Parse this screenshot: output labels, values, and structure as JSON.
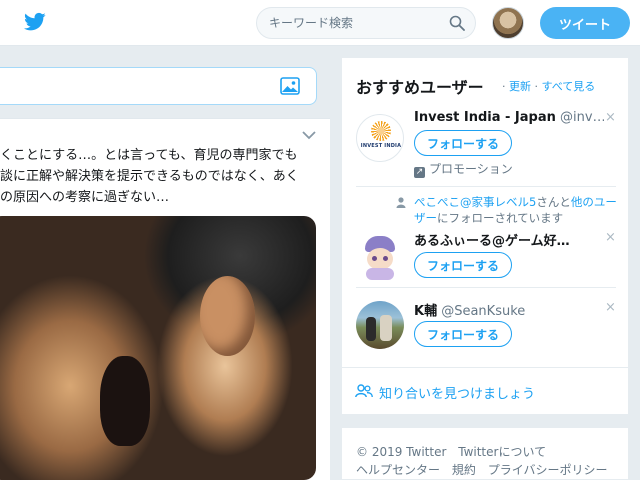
{
  "header": {
    "search_placeholder": "キーワード検索",
    "tweet_button": "ツイート"
  },
  "tweet": {
    "lines": [
      "くことにする…。とは言っても、育児の専門家でも",
      "談に正解や解決策を提示できるものではなく、あく",
      "の原因への考察に過ぎない…"
    ]
  },
  "who_to_follow": {
    "title": "おすすめユーザー",
    "separator": "·",
    "refresh": "更新",
    "view_all": "すべて見る",
    "follow_label": "フォローする",
    "dismiss": "×",
    "users": [
      {
        "name": "Invest India - Japan",
        "handle": "@inv…",
        "promoted": "プロモーション",
        "avatar_text": "INVEST INDIA"
      },
      {
        "context_link": "ぺこぺこ@家事レベル5",
        "context_middle": "さんと",
        "context_link2": "他のユーザー",
        "context_tail": "にフォローされています",
        "name": "あるふぃーる@ゲーム好…",
        "handle": ""
      },
      {
        "name": "K輔",
        "handle": "@SeanKsuke"
      }
    ],
    "find_friends": "知り合いを見つけましょう"
  },
  "footer": {
    "row1": [
      "© 2019 Twitter",
      "Twitterについて"
    ],
    "row2": [
      "ヘルプセンター",
      "規約",
      "プライバシーポリシー"
    ]
  },
  "colors": {
    "accent": "#1da1f2",
    "tweet_button_bg": "#4ab3f4",
    "page_bg": "#e6ecf0"
  }
}
